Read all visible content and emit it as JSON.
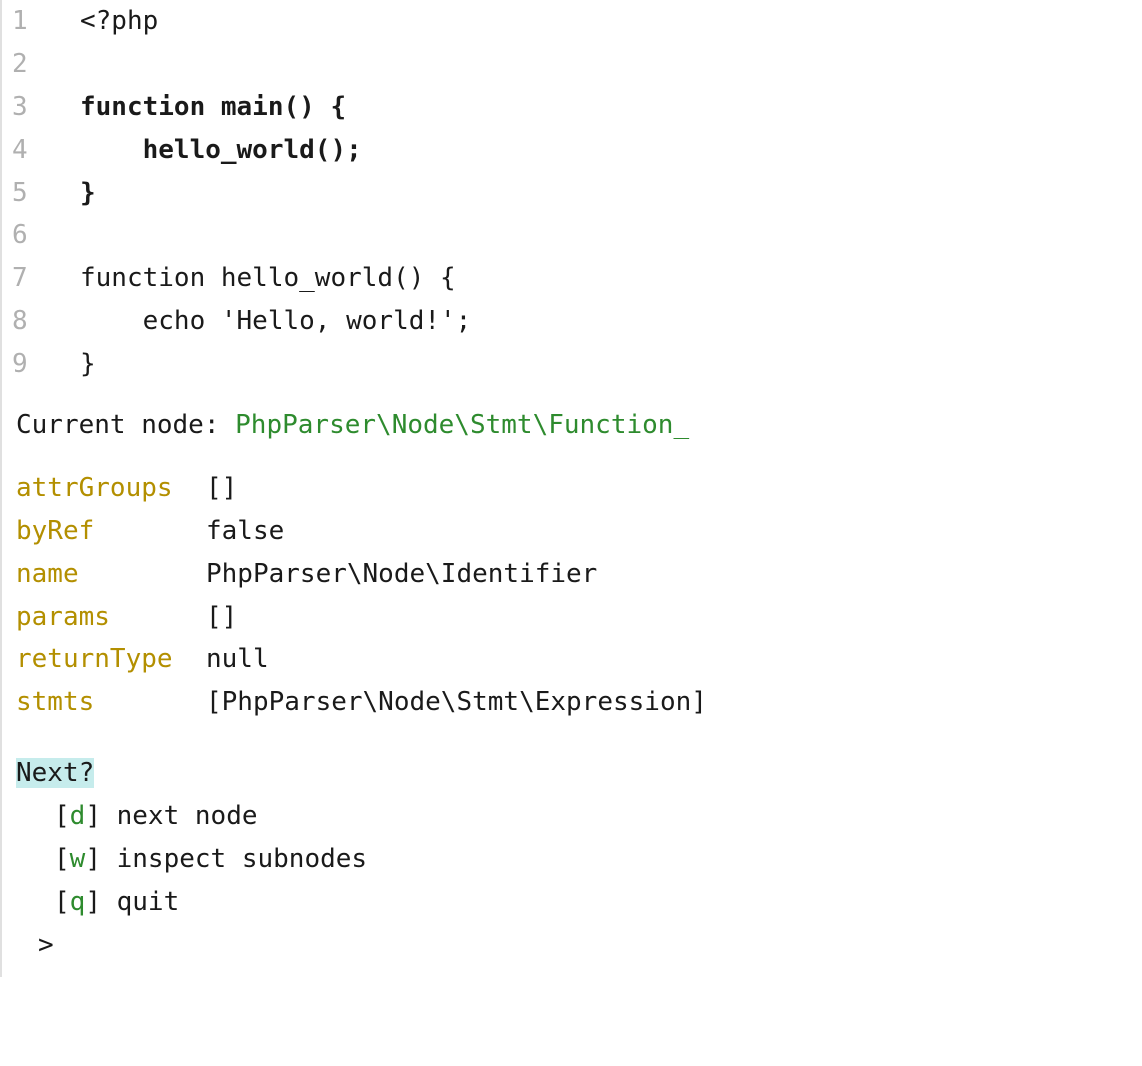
{
  "code": {
    "lines": [
      {
        "n": "1",
        "text": "<?php",
        "bold": false
      },
      {
        "n": "2",
        "text": "",
        "bold": false
      },
      {
        "n": "3",
        "text": "function main() {",
        "bold": true
      },
      {
        "n": "4",
        "text": "    hello_world();",
        "bold": true
      },
      {
        "n": "5",
        "text": "}",
        "bold": true
      },
      {
        "n": "6",
        "text": "",
        "bold": false
      },
      {
        "n": "7",
        "text": "function hello_world() {",
        "bold": false
      },
      {
        "n": "8",
        "text": "    echo 'Hello, world!';",
        "bold": false
      },
      {
        "n": "9",
        "text": "}",
        "bold": false
      }
    ]
  },
  "current": {
    "label": "Current node: ",
    "value": "PhpParser\\Node\\Stmt\\Function_"
  },
  "props": [
    {
      "key": "attrGroups",
      "val": "[]"
    },
    {
      "key": "byRef",
      "val": "false"
    },
    {
      "key": "name",
      "val": "PhpParser\\Node\\Identifier"
    },
    {
      "key": "params",
      "val": "[]"
    },
    {
      "key": "returnType",
      "val": "null"
    },
    {
      "key": "stmts",
      "val": "[PhpParser\\Node\\Stmt\\Expression]"
    }
  ],
  "prompt": {
    "title": "Next?",
    "options": [
      {
        "key": "d",
        "label": "next node"
      },
      {
        "key": "w",
        "label": "inspect subnodes"
      },
      {
        "key": "q",
        "label": "quit"
      }
    ],
    "cursor": ">"
  }
}
